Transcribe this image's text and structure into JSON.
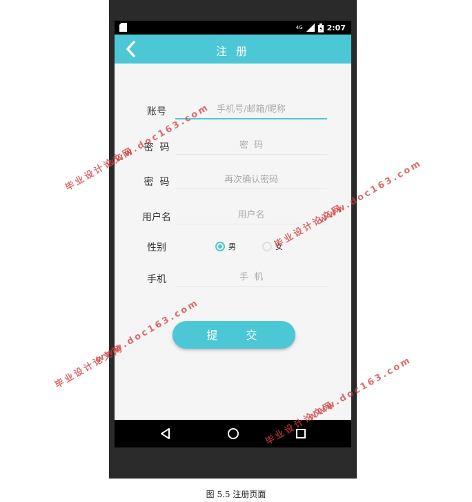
{
  "statusbar": {
    "network": "4G",
    "time": "2:07"
  },
  "appbar": {
    "title": "注 册"
  },
  "form": {
    "account": {
      "label": "账号",
      "placeholder": "手机号/邮箱/昵称"
    },
    "password": {
      "label": "密  码",
      "placeholder": "密  码"
    },
    "confirm": {
      "label": "密  码",
      "placeholder": "再次确认密码"
    },
    "username": {
      "label": "用户名",
      "placeholder": "用户名"
    },
    "gender": {
      "label": "性别",
      "male": "男",
      "female": "女",
      "selected": "男"
    },
    "phone": {
      "label": "手机",
      "placeholder": "手  机"
    },
    "submit_label": "提 交"
  },
  "caption": "图 5.5 注册页面",
  "watermark": {
    "site": "毕业设计论文网",
    "url": "www.doc163.com"
  },
  "colors": {
    "accent": "#4cc7d5",
    "background": "#f5f5f5"
  }
}
